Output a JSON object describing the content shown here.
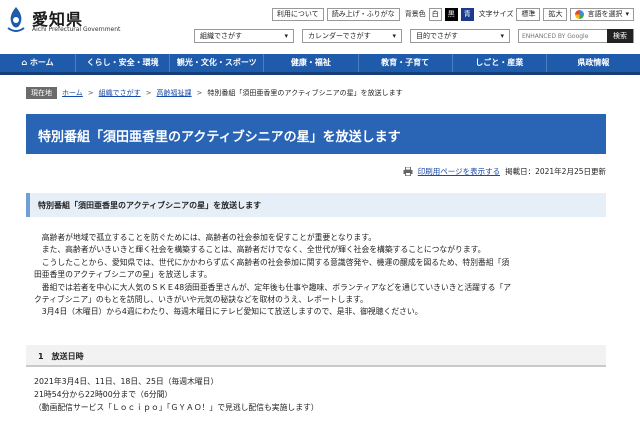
{
  "header": {
    "logo_title": "愛知県",
    "logo_sub": "Aichi Prefectural Government",
    "util": {
      "about": "利用について",
      "reading": "読み上げ・ふりがな",
      "bg_label": "背景色",
      "bg_white": "白",
      "bg_black": "黒",
      "bg_blue": "青",
      "size_label": "文字サイズ",
      "size_standard": "標準",
      "size_large": "拡大",
      "translate": "言語を選択"
    },
    "nav": {
      "org": "組織でさがす",
      "calendar": "カレンダーでさがす",
      "purpose": "目的でさがす",
      "search_placeholder": "ENHANCED BY Google",
      "search_button": "検索"
    }
  },
  "gnav": [
    "ホーム",
    "くらし・安全・環境",
    "観光・文化・スポーツ",
    "健康・福祉",
    "教育・子育て",
    "しごと・産業",
    "県政情報"
  ],
  "breadcrumb": {
    "label": "現在地",
    "items": [
      "ホーム",
      "組織でさがす",
      "高齢福祉課"
    ],
    "current": "特別番組「須田亜香里のアクティブシニアの星」を放送します",
    "separator": ">"
  },
  "page": {
    "title": "特別番組「須田亜香里のアクティブシニアの星」を放送します",
    "print_link": "印刷用ページを表示する",
    "posted": "掲載日：2021年2月25日更新",
    "subheading": "特別番組「須田亜香里のアクティブシニアの星」を放送します",
    "paragraphs": [
      "　高齢者が地域で孤立することを防ぐためには、高齢者の社会参加を促すことが重要となります。",
      "　また、高齢者がいきいきと輝く社会を構築することは、高齢者だけでなく、全世代が輝く社会を構築することにつながります。",
      "　こうしたことから、愛知県では、世代にかかわらず広く高齢者の社会参加に関する意識啓発や、機運の醸成を図るため、特別番組「須",
      "田亜香里のアクティブシニアの星」を放送します。",
      "　番組では若者を中心に大人気のＳＫＥ48須田亜香里さんが、定年後も仕事や趣味、ボランティアなどを通じていきいきと活躍する「ア",
      "クティブシニア」のもとを訪問し、いきがいや元気の秘訣などを取材のうえ、レポートします。",
      "　3月4日（木曜日）から4週にわたり、毎週木曜日にテレビ愛知にて放送しますので、是非、御視聴ください。"
    ],
    "section_title": "1　放送日時",
    "schedule": [
      "2021年3月4日、11日、18日、25日（毎週木曜日）",
      "21時54分から22時00分まで（6分間）",
      "（動画配信サービス「Ｌｏｃｉｐｏ」「ＧＹＡＯ！」で見逃し配信も実施します）"
    ]
  },
  "colors": {
    "nav_blue": "#1f5bab",
    "title_blue": "#2a64b5",
    "link": "#1a4aa8"
  }
}
